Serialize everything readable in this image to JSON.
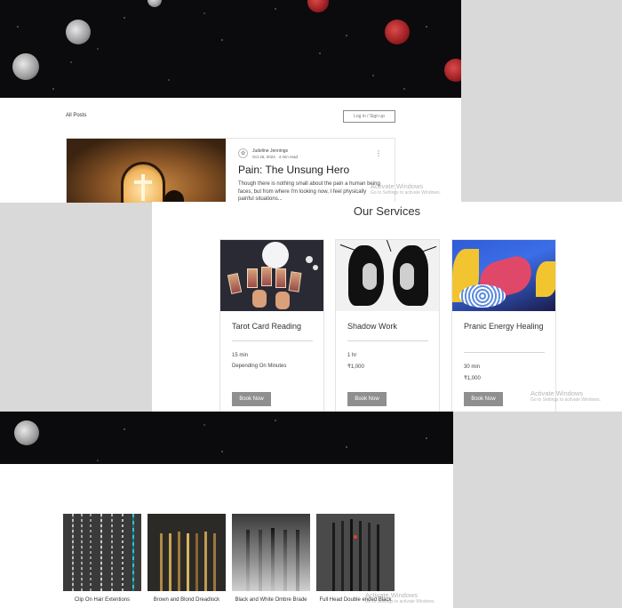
{
  "blog": {
    "nav": {
      "all_posts": "All Posts",
      "login": "Log in / Sign up"
    },
    "post": {
      "author": "Judeline Jennings",
      "date": "Oct 26, 2024",
      "read_time": "4 min read",
      "title": "Pain: The Unsung Hero",
      "excerpt": "Though there is nothing small about the pain a human being faces, but from where I'm looking now, I feel physically painful situations..."
    }
  },
  "services": {
    "title": "Our Services",
    "items": [
      {
        "name": "Tarot Card Reading",
        "duration": "15 min",
        "price": "Depending On Minutes",
        "button": "Book Now"
      },
      {
        "name": "Shadow Work",
        "duration": "1 hr",
        "price": "₹1,000",
        "button": "Book Now"
      },
      {
        "name": "Pranic Energy Healing",
        "duration": "30 min",
        "price": "₹1,000",
        "button": "Book Now"
      }
    ]
  },
  "products": {
    "items": [
      {
        "name": "Clip On Hair Extentions"
      },
      {
        "name": "Brown and Blond Dreadlock"
      },
      {
        "name": "Black and White Ombre Brade"
      },
      {
        "name": "Full Head Double ended Black"
      }
    ]
  },
  "watermark": {
    "line1": "Activate Windows",
    "line2": "Go to Settings to activate Windows."
  },
  "colors": {
    "button_grey": "#8f8f8f",
    "space_bg": "#0b0a0d",
    "moon_red": "#9d1e22"
  },
  "icons": [
    "more-vertical-icon",
    "author-avatar-icon"
  ]
}
